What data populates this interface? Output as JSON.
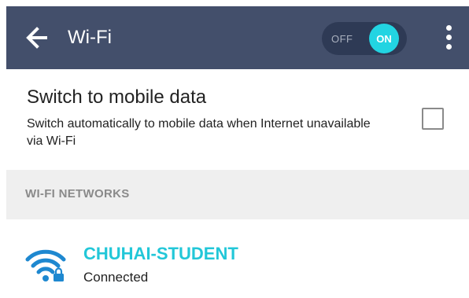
{
  "app_bar": {
    "title": "Wi-Fi",
    "back_icon": "arrow-left-icon",
    "toggle": {
      "off_label": "OFF",
      "on_label": "ON",
      "state": "on"
    },
    "overflow_icon": "more-vertical-icon",
    "background_color": "#434f6b"
  },
  "mobile_data_option": {
    "title": "Switch to mobile data",
    "description": "Switch automatically to mobile data when Internet unavailable via Wi-Fi",
    "checked": false
  },
  "networks_section": {
    "header": "WI-FI NETWORKS",
    "networks": [
      {
        "name": "CHUHAI-STUDENT",
        "status": "Connected",
        "icon": "wifi-secured-icon",
        "accent_color": "#22c7d8"
      }
    ]
  }
}
